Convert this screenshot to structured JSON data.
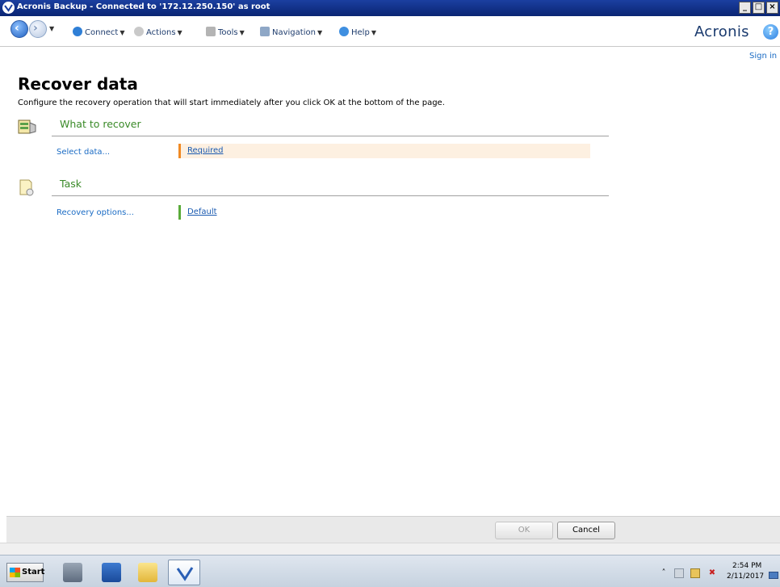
{
  "window": {
    "title": "Acronis Backup - Connected to '172.12.250.150' as root",
    "controls": [
      "_",
      "□",
      "×"
    ]
  },
  "toolbar": {
    "menus": [
      {
        "label": "Connect",
        "icon": "globe-icon"
      },
      {
        "label": "Actions",
        "icon": "gears-icon"
      },
      {
        "label": "Tools",
        "icon": "tools-icon"
      },
      {
        "label": "Navigation",
        "icon": "navigation-icon"
      },
      {
        "label": "Help",
        "icon": "help-icon"
      }
    ],
    "brand": "Acronis",
    "brand_help": "?"
  },
  "signin": "Sign in",
  "page": {
    "title": "Recover data",
    "description": "Configure the recovery operation that will start immediately after you click OK at the bottom of the page."
  },
  "sections": [
    {
      "title": "What to recover",
      "icon": "archive-icon",
      "row_label": "Select data...",
      "row_value": "Required",
      "status_color": "#f08a24",
      "highlight_color": "#fdf0e1"
    },
    {
      "title": "Task",
      "icon": "task-icon",
      "row_label": "Recovery options...",
      "row_value": "Default",
      "status_color": "#5aab3a"
    }
  ],
  "footer": {
    "ok_label": "OK",
    "cancel_label": "Cancel"
  },
  "taskbar": {
    "start_label": "Start",
    "items": [
      "server-manager-icon",
      "powershell-icon",
      "explorer-icon",
      "acronis-icon"
    ],
    "clock_time": "2:54 PM",
    "clock_date": "2/11/2017"
  },
  "colors": {
    "titlebar": "#0a2573",
    "section_title": "#3a8a28",
    "link": "#1a6bc4"
  }
}
